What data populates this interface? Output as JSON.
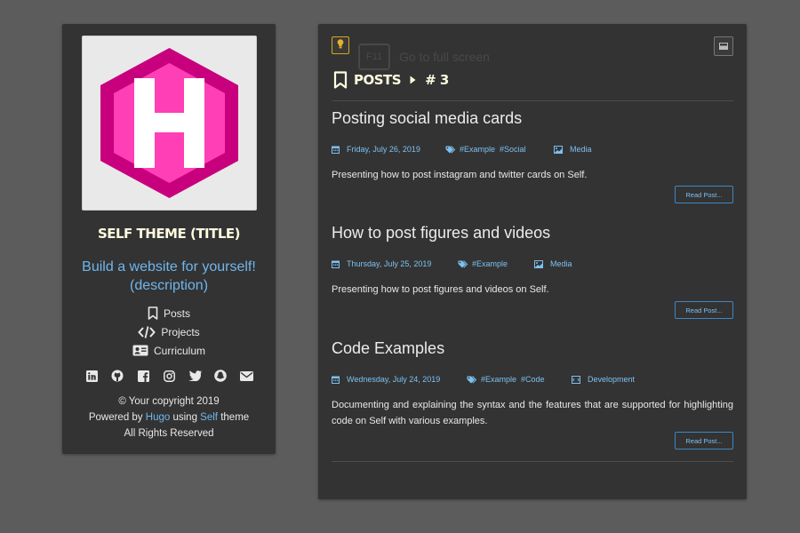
{
  "sidebar": {
    "title": "SELF THEME (TITLE)",
    "description": "Build a website for yourself! (description)",
    "logo_letter": "H",
    "nav": [
      {
        "label": "Posts",
        "icon": "bookmark-icon"
      },
      {
        "label": "Projects",
        "icon": "code-icon"
      },
      {
        "label": "Curriculum",
        "icon": "id-card-icon"
      }
    ],
    "social_icons": [
      "linkedin-icon",
      "github-icon",
      "facebook-icon",
      "instagram-icon",
      "twitter-icon",
      "snapchat-icon",
      "envelope-icon"
    ],
    "footer": {
      "copyright": "© Your copyright 2019",
      "powered_prefix": "Powered by",
      "hugo": "Hugo",
      "using": "using",
      "self": "Self",
      "theme": "theme",
      "rights": "All Rights Reserved"
    }
  },
  "main": {
    "ghost_key": "F11",
    "ghost_text": "Go to full screen",
    "breadcrumb": {
      "section": "POSTS",
      "page": "# 3"
    },
    "posts": [
      {
        "title": "Posting social media cards",
        "date": "Friday, July 26, 2019",
        "tags": [
          "#Example",
          "#Social"
        ],
        "category": "Media",
        "excerpt": "Presenting how to post instagram and twitter cards on Self.",
        "read_more": "Read Post..."
      },
      {
        "title": "How to post figures and videos",
        "date": "Thursday, July 25, 2019",
        "tags": [
          "#Example"
        ],
        "category": "Media",
        "excerpt": "Presenting how to post figures and videos on Self.",
        "read_more": "Read Post..."
      },
      {
        "title": "Code Examples",
        "date": "Wednesday, July 24, 2019",
        "tags": [
          "#Example",
          "#Code"
        ],
        "category": "Development",
        "excerpt": "Documenting and explaining the syntax and the features that are supported for highlighting code on Self with various examples.",
        "read_more": "Read Post..."
      }
    ]
  },
  "colors": {
    "background": "#5c5c5c",
    "panel": "#333333",
    "accent_blue": "#6fb6ec",
    "title_cream": "#fffce0",
    "logo_pink": "#ff3fb5",
    "logo_magenta": "#c8007e",
    "bulb_yellow": "#d9a520"
  }
}
